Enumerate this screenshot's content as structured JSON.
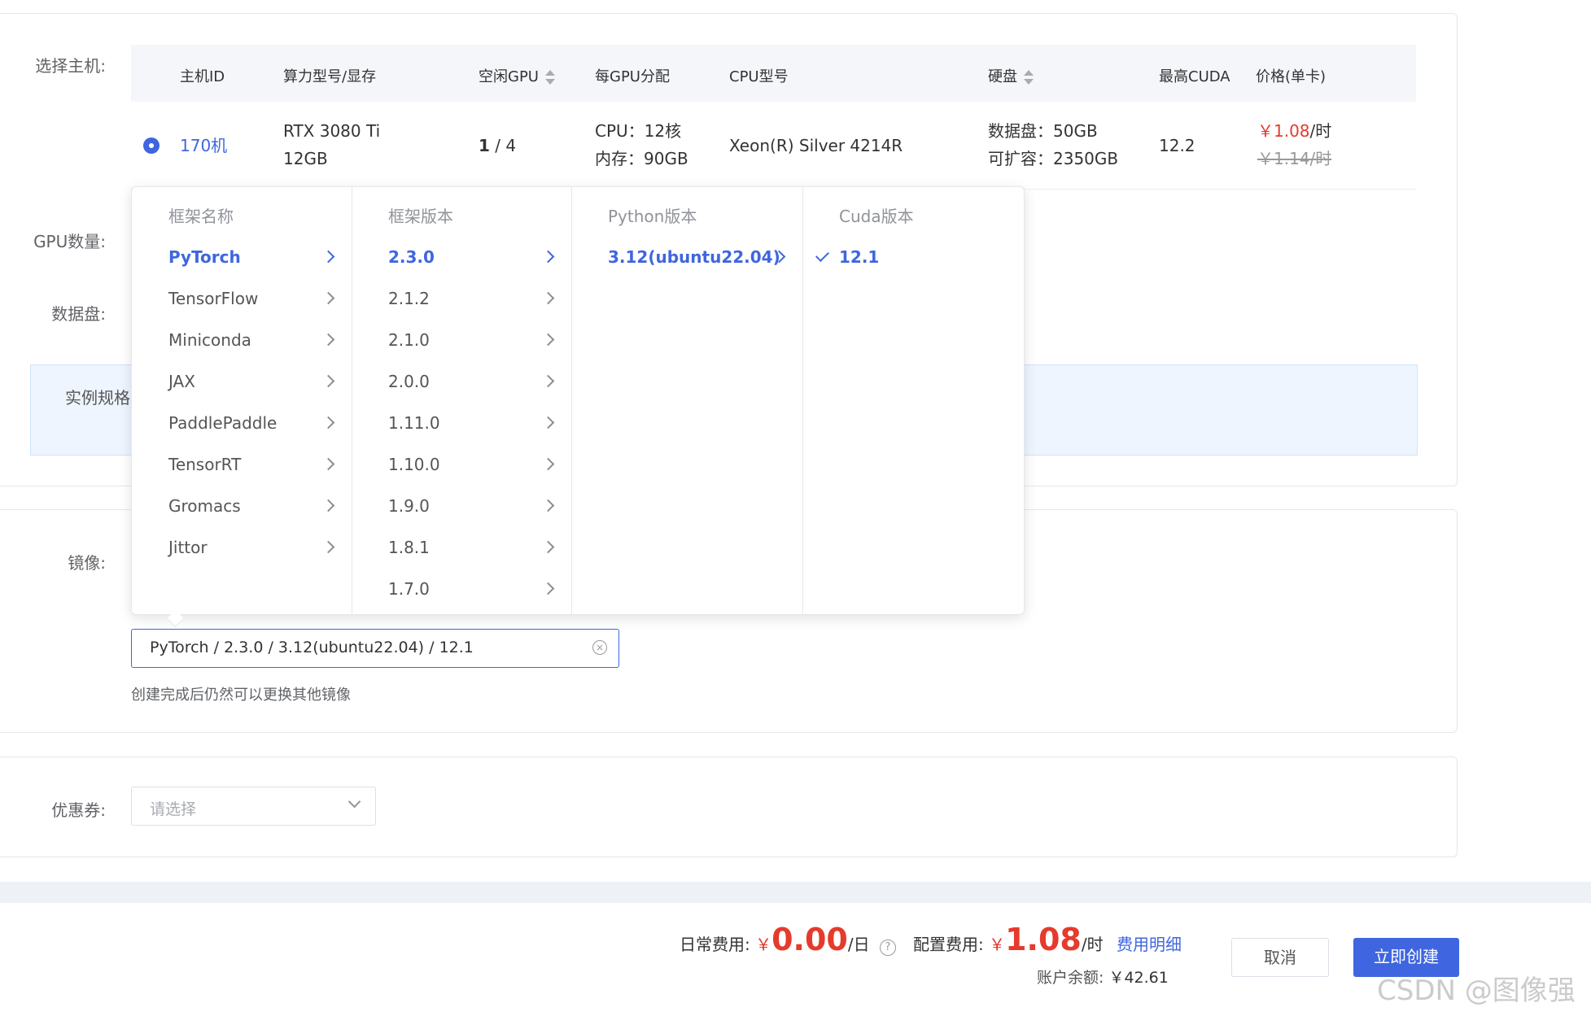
{
  "host": {
    "label": "选择主机:",
    "headers": {
      "host_id": "主机ID",
      "gpu_model": "算力型号/显存",
      "idle_gpu": "空闲GPU",
      "per_gpu": "每GPU分配",
      "cpu_model": "CPU型号",
      "disk": "硬盘",
      "max_cuda": "最高CUDA",
      "price": "价格(单卡)"
    },
    "row": {
      "host_id": "170机",
      "gpu_model": "RTX 3080 Ti",
      "vram": "12GB",
      "idle_gpu_available": "1",
      "idle_gpu_total": " / 4",
      "cpu": "CPU：12核",
      "memory": "内存：90GB",
      "cpu_model": "Xeon(R) Silver 4214R",
      "data_disk": "数据盘：50GB",
      "expandable": "可扩容：2350GB",
      "max_cuda": "12.2",
      "price": "￥1.08",
      "price_unit": "/时",
      "original_price": "￥1.14/时"
    }
  },
  "labels": {
    "gpu_count": "GPU数量:",
    "data_disk": "数据盘:",
    "instance_spec": "实例规格",
    "image": "镜像:",
    "coupon": "优惠券:"
  },
  "cascader": {
    "framework_title": "框架名称",
    "frameworks": [
      "PyTorch",
      "TensorFlow",
      "Miniconda",
      "JAX",
      "PaddlePaddle",
      "TensorRT",
      "Gromacs",
      "Jittor"
    ],
    "version_title": "框架版本",
    "versions": [
      "2.3.0",
      "2.1.2",
      "2.1.0",
      "2.0.0",
      "1.11.0",
      "1.10.0",
      "1.9.0",
      "1.8.1",
      "1.7.0"
    ],
    "python_title": "Python版本",
    "python_versions": [
      "3.12(ubuntu22.04)"
    ],
    "cuda_title": "Cuda版本",
    "cuda_versions": [
      "12.1"
    ]
  },
  "image": {
    "value": "PyTorch / 2.3.0 / 3.12(ubuntu22.04) / 12.1",
    "hint": "创建完成后仍然可以更换其他镜像"
  },
  "coupon": {
    "placeholder": "请选择"
  },
  "footer": {
    "daily_label": "日常费用:",
    "daily_currency": "￥",
    "daily_amount": "0.00",
    "daily_unit": "/日",
    "config_label": "配置费用:",
    "config_currency": "￥",
    "config_amount": "1.08",
    "config_unit": "/时",
    "detail_link": "费用明细",
    "balance_label": "账户余额:",
    "balance_value": "￥42.61",
    "cancel": "取消",
    "create": "立即创建"
  },
  "watermark": "CSDN @图像强",
  "colors": {
    "accent": "#3f66e0",
    "price_red": "#e53b2c"
  }
}
